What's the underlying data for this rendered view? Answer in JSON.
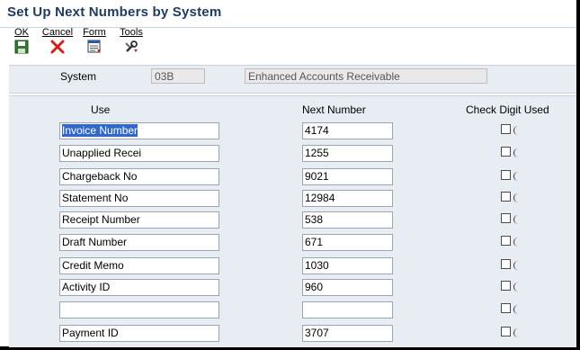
{
  "window": {
    "title": "Set Up Next Numbers by System"
  },
  "toolbar": {
    "items": [
      {
        "label": "OK",
        "icon": "save-icon"
      },
      {
        "label": "Cancel",
        "icon": "close-icon"
      },
      {
        "label": "Form",
        "icon": "form-icon"
      },
      {
        "label": "Tools",
        "icon": "tools-icon"
      }
    ]
  },
  "header": {
    "system_label": "System",
    "system_code": "03B",
    "system_description": "Enhanced Accounts Receivable"
  },
  "grid": {
    "columns": {
      "use": "Use",
      "next_number": "Next Number",
      "check_digit": "Check Digit Used"
    },
    "rows": [
      {
        "use": "Invoice Number",
        "next_number": "4174",
        "check_digit_used": false
      },
      {
        "use": "Unapplied Recei",
        "next_number": "1255",
        "check_digit_used": false
      },
      {
        "use": "Chargeback No",
        "next_number": "9021",
        "check_digit_used": false
      },
      {
        "use": "Statement No",
        "next_number": "12984",
        "check_digit_used": false
      },
      {
        "use": "Receipt Number",
        "next_number": "538",
        "check_digit_used": false
      },
      {
        "use": "Draft Number",
        "next_number": "671",
        "check_digit_used": false
      },
      {
        "use": "Credit Memo",
        "next_number": "1030",
        "check_digit_used": false
      },
      {
        "use": "Activity ID",
        "next_number": "960",
        "check_digit_used": false
      },
      {
        "use": "",
        "next_number": "",
        "check_digit_used": false
      },
      {
        "use": "Payment ID",
        "next_number": "3707",
        "check_digit_used": false
      }
    ]
  },
  "colors": {
    "title": "#1f3b61",
    "panel": "#e8edf4",
    "selection": "#3167c7"
  }
}
